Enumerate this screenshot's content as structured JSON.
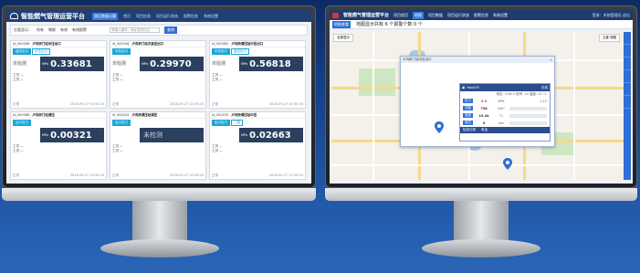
{
  "left": {
    "app_title": "智能燃气管理运营平台",
    "nav": [
      "测压数据计算",
      "首页",
      "项目信息",
      "项目运行状态",
      "报警信息",
      "系统设置"
    ],
    "filter": {
      "label": "分类显示：",
      "options": [
        "所有",
        "物联",
        "有线",
        "有线报警"
      ],
      "placeholder": "请输入编号、地址或测试点",
      "query_button": "查询"
    },
    "cards": [
      {
        "id": "id_000066",
        "name": "卢沟桥门站中压出口",
        "tabs": [
          "高压出口",
          "中压出口"
        ],
        "state": "未检测",
        "value": "0.33681",
        "unit": "MPa"
      },
      {
        "id": "id_000046",
        "name": "卢沟桥门站次高压出口",
        "tabs": [
          "中压出口"
        ],
        "state": "未检测",
        "value": "0.29970",
        "unit": "MPa"
      },
      {
        "id": "id_000082",
        "name": "卢沟桥调压站中压出口",
        "tabs": [
          "中压出口",
          "高压出口"
        ],
        "state": "未检测",
        "value": "0.56818",
        "unit": "MPa"
      },
      {
        "id": "id_000088",
        "name": "卢沟桥门站调压",
        "tabs": [
          "出口压力"
        ],
        "state": "",
        "value": "0.00321",
        "unit": "MPa"
      },
      {
        "id": "id_000045",
        "name": "卢沟桥调压站调压",
        "tabs": [
          "出口压力"
        ],
        "state": "",
        "value": "未检测",
        "unit": ""
      },
      {
        "id": "id_000035",
        "name": "卢沟桥调压站中压",
        "tabs": [
          "出口压力",
          "二路"
        ],
        "state": "",
        "value": "0.02663",
        "unit": "MPa"
      }
    ],
    "card_rows": [
      "工况 —",
      "工况 —"
    ],
    "card_foot": [
      "正常",
      "2018-09-27 10:30:20"
    ]
  },
  "right": {
    "app_title": "智能燃气管理运营平台",
    "nav": [
      "项目首页",
      "地图",
      "项目数据",
      "项目运行状态",
      "报警信息",
      "系统设置"
    ],
    "user": "登录：系统管理员   退出",
    "sub_tab": "地图查看",
    "breadcrumb": "地图显示共有 6 个报警个数 0 个",
    "map_controls_left": "全部显示",
    "map_controls_right": "卫星  地图",
    "popup_title": "卢沟桥门站中压出口",
    "device": {
      "id": "Hao005",
      "status": "在线",
      "info": "电压: 3.56 V  信号: 14  温度: 12 °C",
      "rows": [
        {
          "k": "压力",
          "v": "4.5",
          "u": "MPa",
          "r": "1-12",
          "red": true
        },
        {
          "k": "流量",
          "v": "738",
          "u": "Nm³",
          "r": "",
          "red": false
        },
        {
          "k": "温度",
          "v": "19.44",
          "u": "°C",
          "r": "",
          "red": false
        },
        {
          "k": "液位",
          "v": "0",
          "u": "mm",
          "r": "",
          "red": false
        }
      ],
      "footer": [
        "检查记录",
        "电话"
      ]
    }
  }
}
